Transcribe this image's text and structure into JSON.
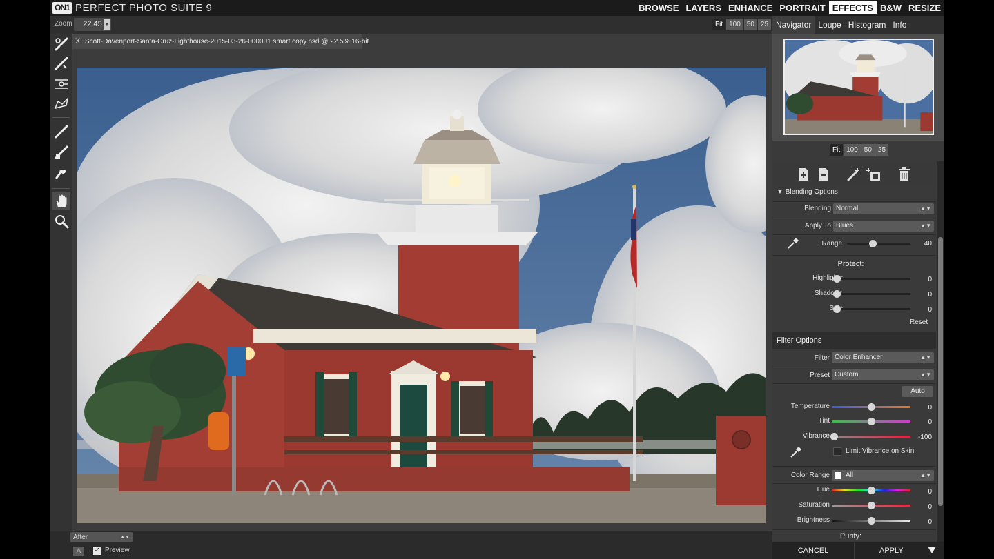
{
  "app": {
    "logo": "ON1",
    "title": "PERFECT PHOTO SUITE 9",
    "modules": [
      "BROWSE",
      "LAYERS",
      "ENHANCE",
      "PORTRAIT",
      "EFFECTS",
      "B&W",
      "RESIZE"
    ],
    "active_module": "EFFECTS"
  },
  "zoom": {
    "label": "Zoom",
    "value": "22.45",
    "fit_buttons": [
      "Fit",
      "100",
      "50",
      "25"
    ],
    "selected_fit": "Fit"
  },
  "file": {
    "close": "X",
    "name": "Scott-Davenport-Santa-Cruz-Lighthouse-2015-03-26-000001 smart copy.psd @ 22.5% 16-bit"
  },
  "bottom": {
    "view_mode": "After",
    "a_label": "A",
    "preview_label": "Preview",
    "preview_checked": true
  },
  "right_tabs": [
    "Navigator",
    "Loupe",
    "Histogram",
    "Info"
  ],
  "nav_fit": [
    "Fit",
    "100",
    "50",
    "25"
  ],
  "blending": {
    "header": "Blending Options",
    "blending_label": "Blending",
    "blending_value": "Normal",
    "apply_label": "Apply To",
    "apply_value": "Blues",
    "range_label": "Range",
    "range_value": "40",
    "range_fraction": 0.4,
    "protect_title": "Protect:",
    "highlights_label": "Highlights",
    "highlights_value": "0",
    "shadows_label": "Shadows",
    "shadows_value": "0",
    "skin_label": "Skin",
    "skin_value": "0",
    "reset": "Reset"
  },
  "filter": {
    "header": "Filter Options",
    "filter_label": "Filter",
    "filter_value": "Color Enhancer",
    "preset_label": "Preset",
    "preset_value": "Custom",
    "auto": "Auto",
    "temperature_label": "Temperature",
    "temperature_value": "0",
    "tint_label": "Tint",
    "tint_value": "0",
    "vibrance_label": "Vibrance",
    "vibrance_value": "-100",
    "limit_label": "Limit Vibrance on Skin",
    "color_range_label": "Color Range",
    "color_range_value": "All",
    "hue_label": "Hue",
    "hue_value": "0",
    "saturation_label": "Saturation",
    "saturation_value": "0",
    "brightness_label": "Brightness",
    "brightness_value": "0",
    "purity_label": "Purity:"
  },
  "footer": {
    "cancel": "CANCEL",
    "apply": "APPLY"
  }
}
